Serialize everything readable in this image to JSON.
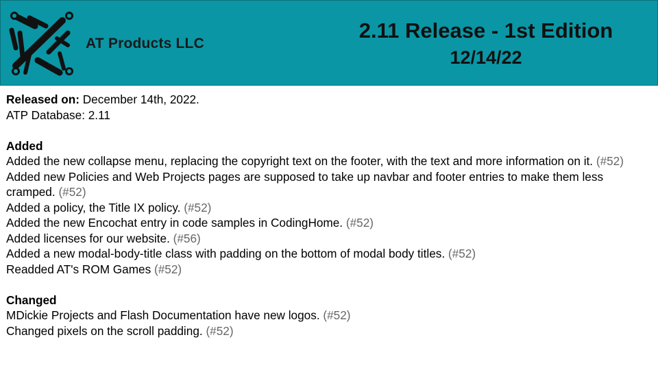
{
  "header": {
    "company_name": "AT Products LLC",
    "title": "2.11 Release - 1st Edition",
    "date": "12/14/22",
    "background_color": "#0a96a5",
    "logo_icon": "circuit-logo-icon"
  },
  "release_info": {
    "released_on_label": "Released on:",
    "released_on_value": "December 14th, 2022.",
    "database_line": "ATP Database: 2.11"
  },
  "added": {
    "heading": "Added",
    "items": [
      {
        "text": "Added the new collapse menu, replacing the copyright text on the footer, with the text and more information on it.",
        "ref": "(#52)"
      },
      {
        "text": "Added new Policies and Web Projects pages are supposed to take up navbar and footer entries to make them less cramped.",
        "ref": "(#52)"
      },
      {
        "text": "Added a policy, the Title IX policy.",
        "ref": "(#52)"
      },
      {
        "text": "Added the new Encochat entry in code samples in CodingHome.",
        "ref": "(#52)"
      },
      {
        "text": "Added licenses for our website.",
        "ref": "(#56)"
      },
      {
        "text": "Added a new modal-body-title class with padding on the bottom of modal body titles.",
        "ref": "(#52)"
      },
      {
        "text": "Readded AT's ROM Games",
        "ref": "(#52)"
      }
    ]
  },
  "changed": {
    "heading": "Changed",
    "items": [
      {
        "text": "MDickie Projects and Flash Documentation have new logos.",
        "ref": "(#52)"
      },
      {
        "text": "Changed pixels on the scroll padding.",
        "ref": "(#52)"
      }
    ]
  }
}
